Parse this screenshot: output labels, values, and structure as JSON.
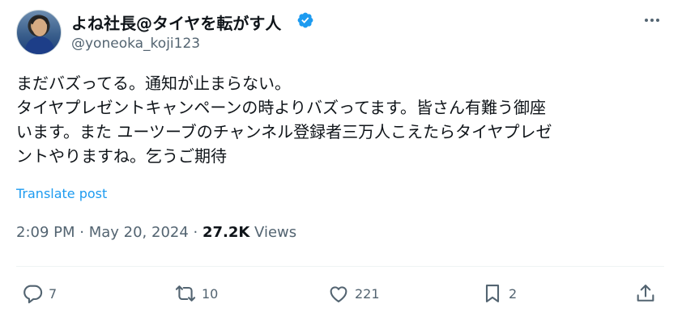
{
  "author": {
    "display_name": "よね社長@タイヤを転がす人",
    "handle": "@yoneoka_koji123",
    "verified": true
  },
  "tweet": {
    "text": "まだバズってる。通知が止まらない。\nタイヤプレゼントキャンペーンの時よりバズってます。皆さん有難う御座\nいます。また ユーツーブのチャンネル登録者三万人こえたらタイヤプレゼ\nントやりますね。乞うご期待",
    "translate_label": "Translate post"
  },
  "meta": {
    "time": "2:09 PM",
    "separator": " · ",
    "date": "May 20, 2024",
    "separator2": " · ",
    "views_count": "27.2K",
    "views_label": " Views"
  },
  "actions": {
    "replies": "7",
    "reposts": "10",
    "likes": "221",
    "bookmarks": "2"
  },
  "colors": {
    "accent": "#1d9bf0",
    "secondary_text": "#536471",
    "divider": "#eff3f4"
  },
  "icons": [
    "verified-badge-icon",
    "more-options-icon",
    "reply-icon",
    "repost-icon",
    "like-icon",
    "bookmark-icon",
    "share-icon"
  ]
}
